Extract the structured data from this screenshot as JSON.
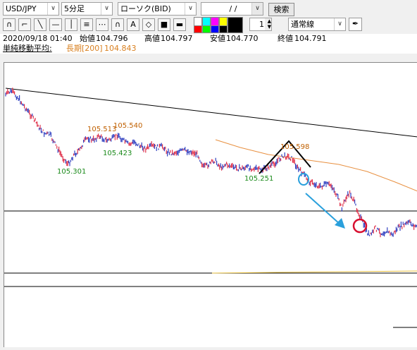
{
  "toolbar": {
    "symbol": "USD/JPY",
    "timeframe": "5分足",
    "chart_type": "ローソク(BID)",
    "date_field": " /  / ",
    "search_button": "検索",
    "count_value": "1",
    "line_type": "通常線",
    "colors": [
      "#ffffff",
      "#00ffff",
      "#ff00ff",
      "#ffff00",
      "#ff0000",
      "#00ff00",
      "#0000ff",
      "#000000"
    ]
  },
  "ohlc": {
    "datetime": "2020/09/18 01:40",
    "open_label": "始値",
    "open": "104.796",
    "high_label": "高値",
    "high": "104.797",
    "low_label": "安値",
    "low": "104.770",
    "close_label": "終値",
    "close": "104.791"
  },
  "moving_average": {
    "label": "単純移動平均:",
    "long_label": "長期[200]",
    "long_value": "104.843",
    "long_color": "#d98020"
  },
  "price_labels": [
    {
      "text": "105.513",
      "color": "#c06000"
    },
    {
      "text": "105.540",
      "color": "#c06000"
    },
    {
      "text": "105.423",
      "color": "#1a8a1a"
    },
    {
      "text": "105.301",
      "color": "#1a8a1a"
    },
    {
      "text": "105.251",
      "color": "#1a8a1a"
    },
    {
      "text": "105.598",
      "color": "#c06000"
    }
  ]
}
